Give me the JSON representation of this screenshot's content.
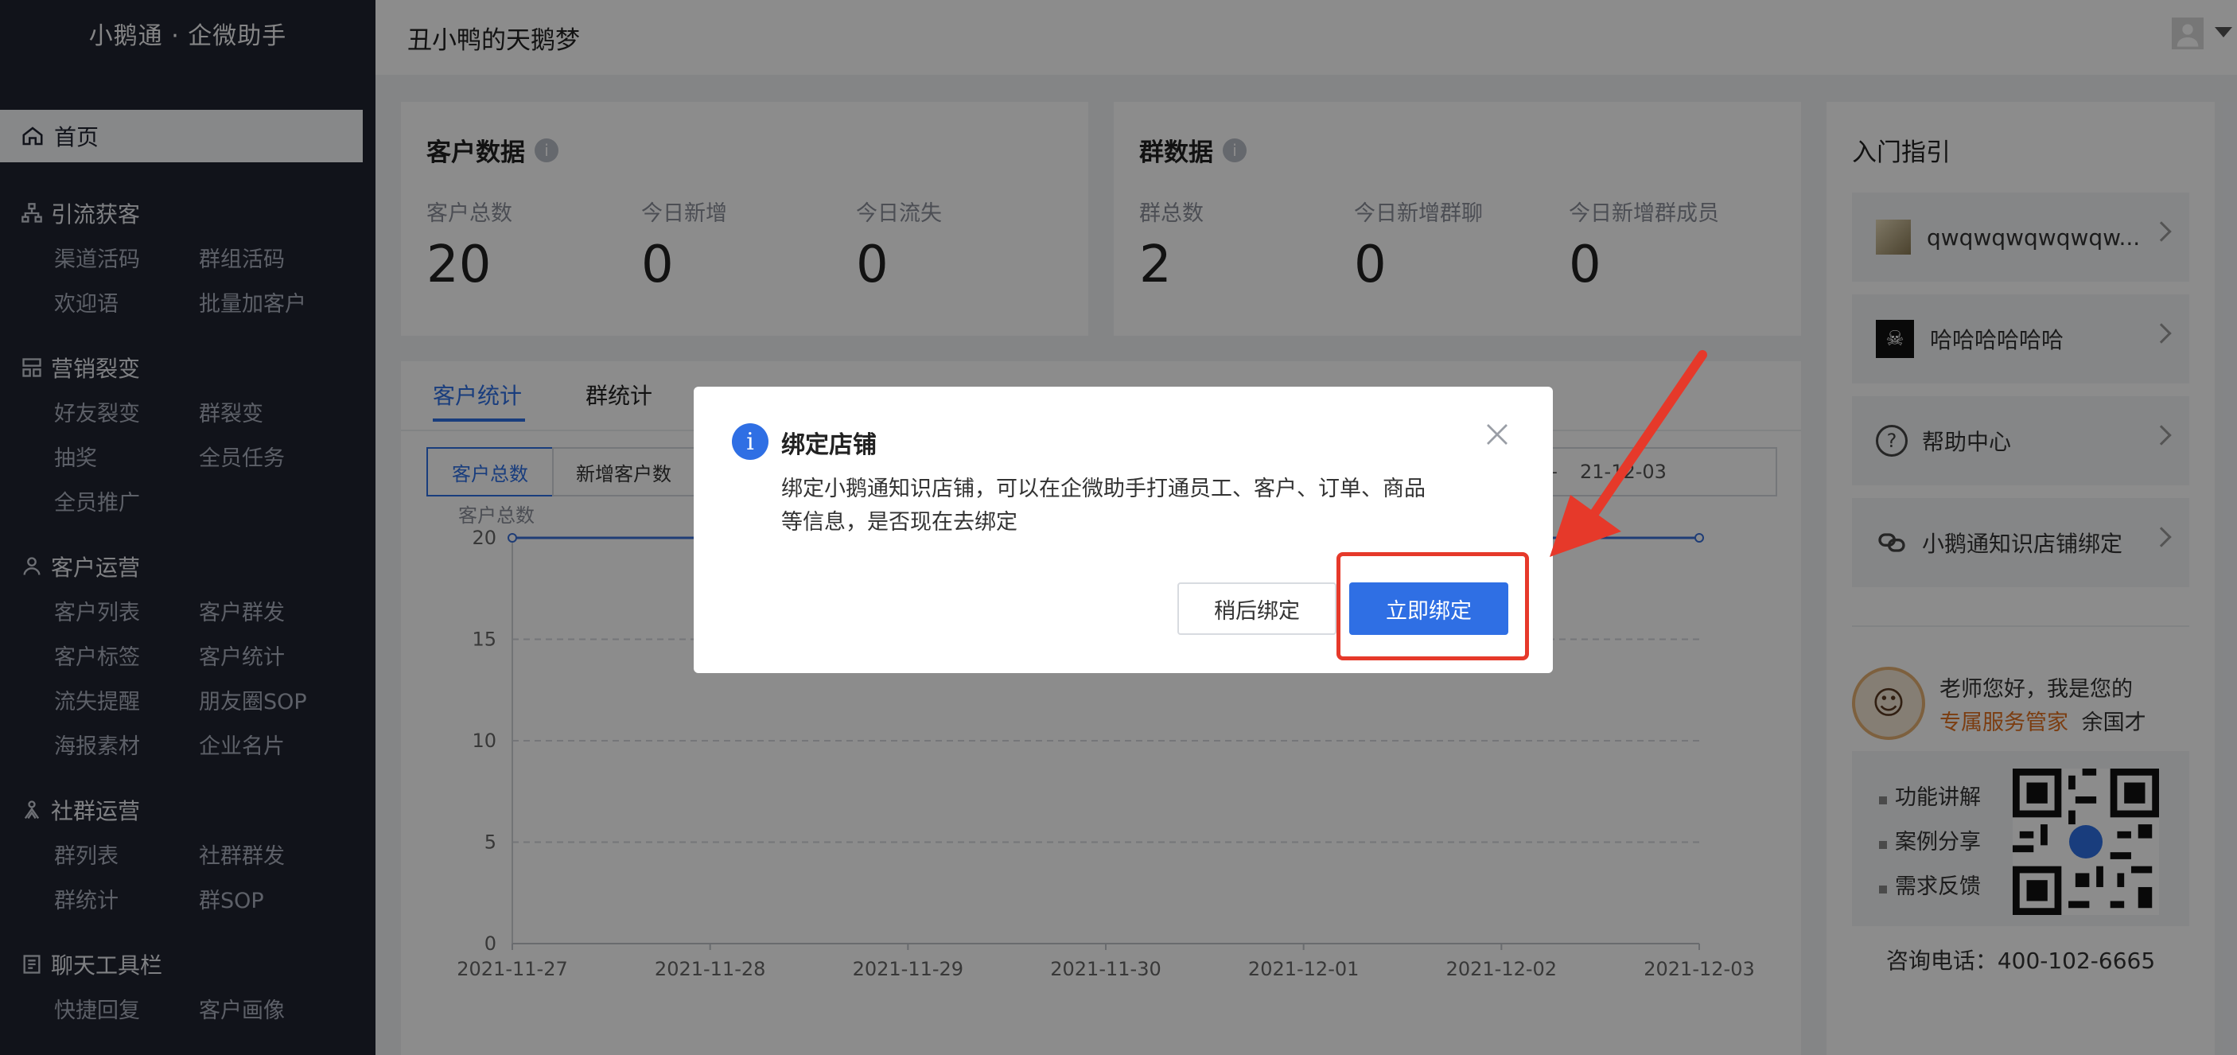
{
  "app": {
    "brand": "小鹅通 · 企微助手",
    "shop_name": "丑小鸭的天鹅梦"
  },
  "sidebar": {
    "home": "首页",
    "groups": [
      {
        "title": "引流获客",
        "icon": "sitemap-icon",
        "items": [
          "渠道活码",
          "群组活码",
          "欢迎语",
          "批量加客户"
        ]
      },
      {
        "title": "营销裂变",
        "icon": "hierarchy-icon",
        "items": [
          "好友裂变",
          "群裂变",
          "抽奖",
          "全员任务",
          "全员推广"
        ]
      },
      {
        "title": "客户运营",
        "icon": "user-icon",
        "items": [
          "客户列表",
          "客户群发",
          "客户标签",
          "客户统计",
          "流失提醒",
          "朋友圈SOP",
          "海报素材",
          "企业名片"
        ]
      },
      {
        "title": "社群运营",
        "icon": "group-icon",
        "items": [
          "群列表",
          "社群群发",
          "群统计",
          "群SOP"
        ]
      },
      {
        "title": "聊天工具栏",
        "icon": "chat-tool-icon",
        "items": [
          "快捷回复",
          "客户画像"
        ]
      }
    ]
  },
  "customer_data": {
    "title": "客户数据",
    "stats": [
      {
        "label": "客户总数",
        "value": "20"
      },
      {
        "label": "今日新增",
        "value": "0"
      },
      {
        "label": "今日流失",
        "value": "0"
      }
    ]
  },
  "group_data": {
    "title": "群数据",
    "stats": [
      {
        "label": "群总数",
        "value": "2"
      },
      {
        "label": "今日新增群聊",
        "value": "0"
      },
      {
        "label": "今日新增群成员",
        "value": "0"
      }
    ]
  },
  "stats_tabs": [
    "客户统计",
    "群统计"
  ],
  "segments": [
    "客户总数",
    "新增客户数"
  ],
  "date_range": {
    "separator": "–",
    "end": "2021-12-03",
    "end_visible": "21-12-03"
  },
  "chart_data": {
    "type": "line",
    "ylabel": "客户总数",
    "x": [
      "2021-11-27",
      "2021-11-28",
      "2021-11-29",
      "2021-11-30",
      "2021-12-01",
      "2021-12-02",
      "2021-12-03"
    ],
    "series": [
      {
        "values": [
          20,
          20,
          20,
          20,
          20,
          20,
          20
        ]
      }
    ],
    "yticks": [
      "0",
      "5",
      "10",
      "15",
      "20"
    ],
    "ylim": [
      0,
      20
    ],
    "grid": true,
    "color": "#3a6fd8"
  },
  "guide": {
    "title": "入门指引",
    "items": [
      {
        "label": "qwqwqwqwqwqw...",
        "icon": "shop-avatar-icon"
      },
      {
        "label": "哈哈哈哈哈哈",
        "icon": "pirate-avatar-icon"
      },
      {
        "label": "帮助中心",
        "icon": "help-icon"
      },
      {
        "label": "小鹅通知识店铺绑定",
        "icon": "link-icon"
      }
    ],
    "manager_line1": "老师您好，我是您的",
    "manager_highlight": "专属服务管家",
    "manager_name": "余国才",
    "bullets": [
      "功能讲解",
      "案例分享",
      "需求反馈"
    ],
    "phone": "咨询电话：400-102-6665"
  },
  "modal": {
    "title": "绑定店铺",
    "body": "绑定小鹅通知识店铺，可以在企微助手打通员工、客户、订单、商品等信息，是否现在去绑定",
    "later": "稍后绑定",
    "now": "立即绑定"
  },
  "colors": {
    "primary": "#2f6fe4",
    "sidebar": "#1f2330",
    "highlight": "#e6392a",
    "accent_orange": "#e0701f"
  }
}
